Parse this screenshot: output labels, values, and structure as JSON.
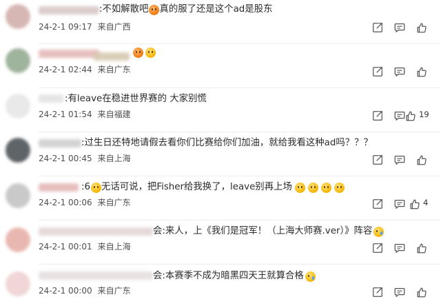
{
  "comments": [
    {
      "text": ":不如解散吧",
      "text_after_emoji": "真的服了还是这个ad是股东",
      "emoji_after": "",
      "date": "24-2-1 09:17",
      "location": "来自广西",
      "likes": "",
      "avatar_color": "#d7b7b4"
    },
    {
      "text": "",
      "text_after_emoji": "",
      "emoji_after": "",
      "date": "24-2-1 02:44",
      "location": "来自广东",
      "likes": "",
      "avatar_color": "#9fb49d"
    },
    {
      "text": ":有leave在稳进世界赛的 大家别慌",
      "text_after_emoji": "",
      "emoji_after": "",
      "date": "24-2-1 01:54",
      "location": "来自福建",
      "likes": "19",
      "avatar_color": "#e9e9ea"
    },
    {
      "text": ":过生日还特地请假去看你们比赛给你们加油，就给我看这种ad吗？？？",
      "text_after_emoji": "",
      "emoji_after": "",
      "date": "24-2-1 00:45",
      "location": "来自上海",
      "likes": "",
      "avatar_color": "#5f6468"
    },
    {
      "text": ":6",
      "text_after_emoji": "无话可说，把Fisher给我换了，leave别再上场",
      "emoji_after": "",
      "date": "24-2-1 00:06",
      "location": "来自广东",
      "likes": "4",
      "avatar_color": "#c9c9c9"
    },
    {
      "text": "会:来人，上《我们是冠军！（上海大师赛.ver）》阵容",
      "text_after_emoji": "",
      "emoji_after": "",
      "date": "24-2-1 00:01",
      "location": "来自上海",
      "likes": "",
      "avatar_color": "#e8b8b0"
    },
    {
      "text": "会:本赛季不成为暗黑四天王就算合格",
      "text_after_emoji": "",
      "emoji_after": "",
      "date": "24-2-1 00:00",
      "location": "来自广东",
      "likes": "",
      "avatar_color": "#f0d6d6"
    }
  ],
  "icons": {
    "share": "share-icon",
    "comment": "comment-icon",
    "like": "thumbs-up-icon"
  },
  "colors": {
    "text": "#2b2b2b",
    "meta": "#4f4f4f",
    "icon": "#555555"
  }
}
